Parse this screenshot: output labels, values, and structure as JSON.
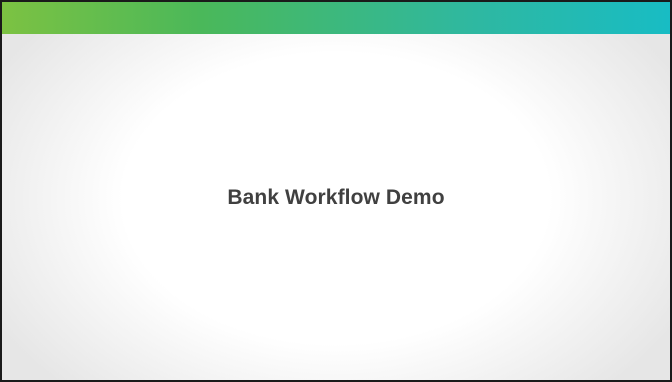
{
  "slide": {
    "title": "Bank Workflow Demo",
    "accent_gradient": [
      "#7cc242",
      "#18bcc4"
    ],
    "title_color": "#404040"
  }
}
